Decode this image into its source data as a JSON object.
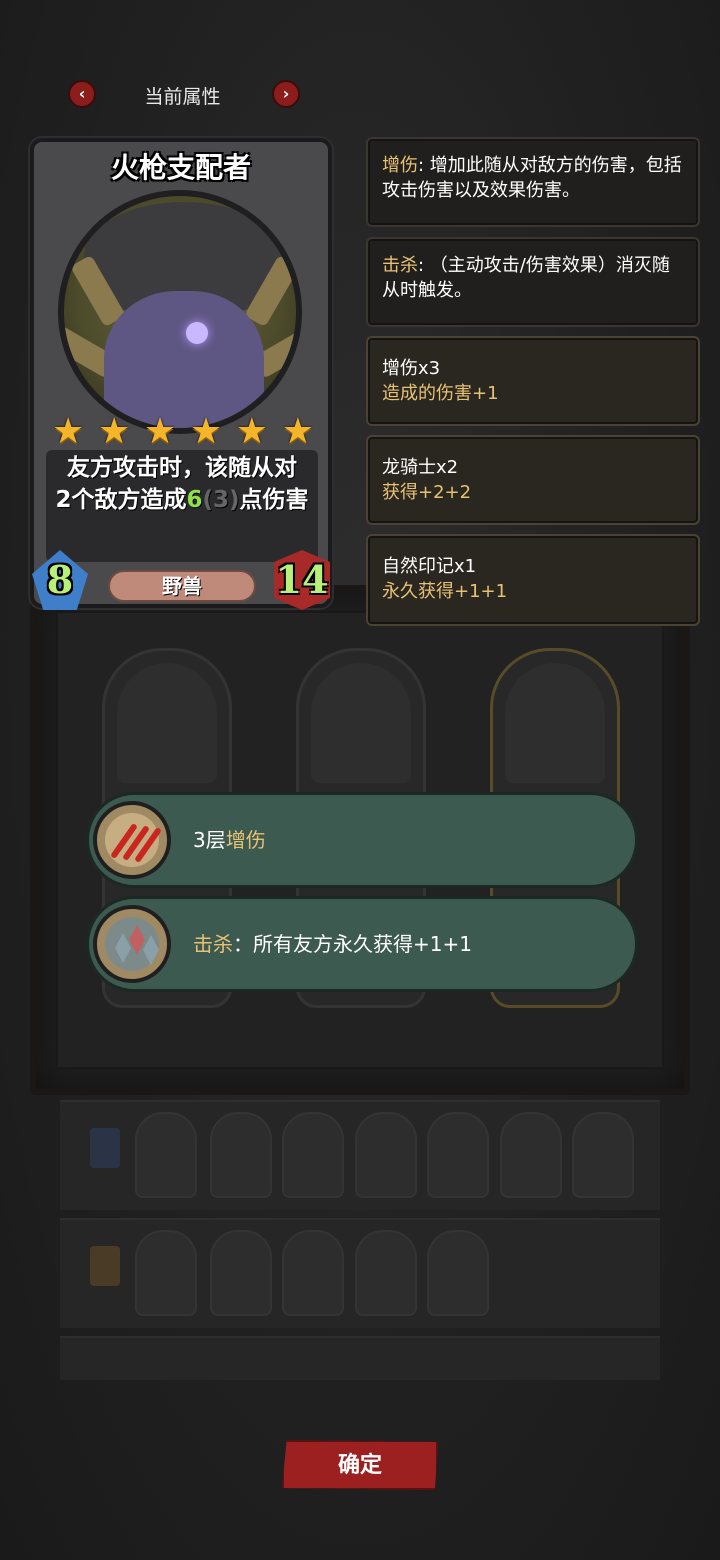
{
  "header": {
    "title": "当前属性",
    "prev_label": "‹",
    "next_label": "›"
  },
  "card": {
    "name": "火枪支配者",
    "stars": 6,
    "description_part1": "友方攻击时，该随从对",
    "description_num": "2",
    "description_part2": "个敌方造成",
    "description_damage": "6",
    "description_base": "(3)",
    "description_part3": "点伤害",
    "tribe": "野兽",
    "attack": "8",
    "health": "14",
    "colors": {
      "attack_bg": "#3f7ec9",
      "health_bg": "#a82a28",
      "stat_text": "#b9f07a",
      "star": "#f4b52a"
    }
  },
  "keywords": [
    {
      "term": "增伤",
      "separator": ": ",
      "text": "增加此随从对敌方的伤害，包括攻击伤害以及效果伤害。"
    },
    {
      "term": "击杀",
      "separator": ": ",
      "text": "（主动攻击/伤害效果）消灭随从时触发。"
    }
  ],
  "buffs": [
    {
      "title": "增伤x3",
      "detail": "造成的伤害+1"
    },
    {
      "title": "龙骑士x2",
      "detail": "获得+2+2"
    },
    {
      "title": "自然印记x1",
      "detail": "永久获得+1+1"
    }
  ],
  "banners": [
    {
      "prefix": "3层",
      "keyword": "增伤",
      "suffix": "",
      "icon": "claw-slash-icon"
    },
    {
      "prefix": "",
      "keyword": "击杀",
      "suffix": "：所有友方永久获得+1+1",
      "icon": "crystal-shards-icon"
    }
  ],
  "confirm_label": "确定",
  "accent_colors": {
    "keyword": "#e8c274",
    "banner_bg": "#3d5a50",
    "confirm_bg": "#9d2020"
  }
}
